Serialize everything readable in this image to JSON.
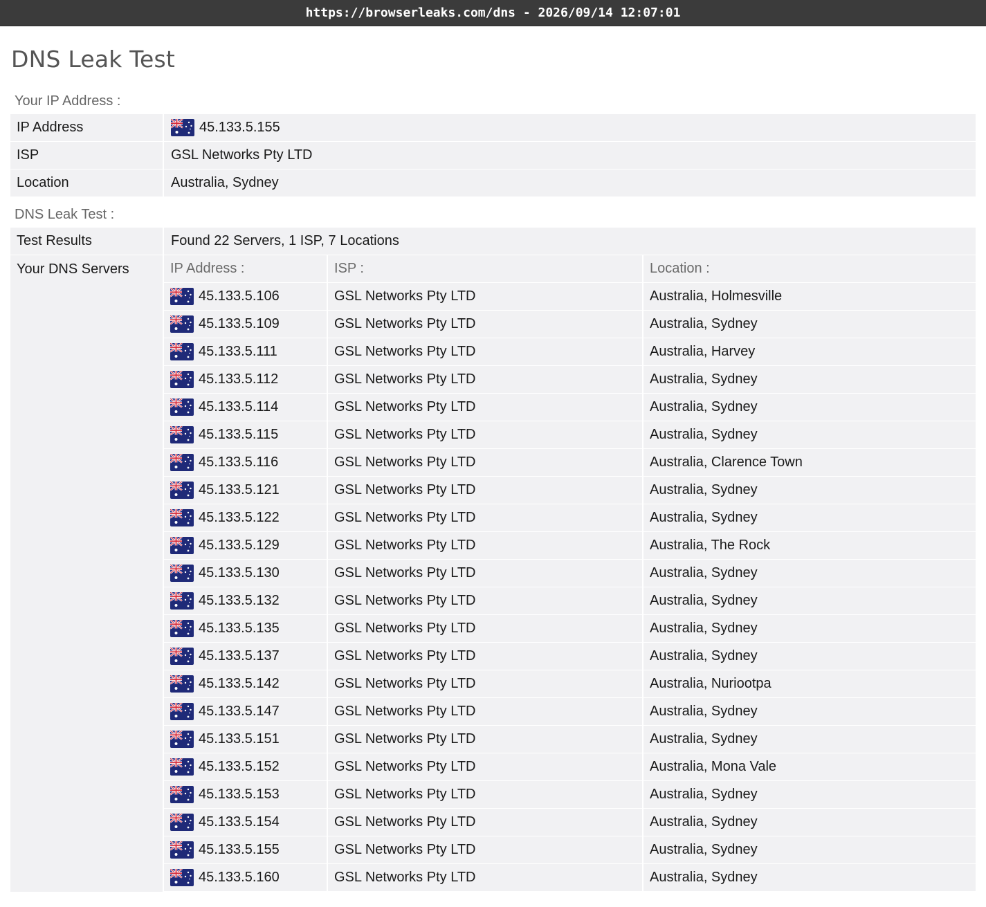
{
  "browser": {
    "url_timestamp": "https://browserleaks.com/dns - 2026/09/14 12:07:01"
  },
  "page": {
    "title": "DNS Leak Test"
  },
  "ip_section": {
    "heading": "Your IP Address :",
    "rows": [
      {
        "label": "IP Address",
        "value": "45.133.5.155",
        "flag": "australia-flag-icon"
      },
      {
        "label": "ISP",
        "value": "GSL Networks Pty LTD"
      },
      {
        "label": "Location",
        "value": "Australia, Sydney"
      }
    ]
  },
  "dns_section": {
    "heading": "DNS Leak Test :",
    "results_label": "Test Results",
    "results_value": "Found 22 Servers, 1 ISP, 7 Locations",
    "servers_label": "Your DNS Servers",
    "columns": [
      "IP Address :",
      "ISP :",
      "Location :"
    ],
    "servers": [
      {
        "ip": "45.133.5.106",
        "isp": "GSL Networks Pty LTD",
        "location": "Australia, Holmesville"
      },
      {
        "ip": "45.133.5.109",
        "isp": "GSL Networks Pty LTD",
        "location": "Australia, Sydney"
      },
      {
        "ip": "45.133.5.111",
        "isp": "GSL Networks Pty LTD",
        "location": "Australia, Harvey"
      },
      {
        "ip": "45.133.5.112",
        "isp": "GSL Networks Pty LTD",
        "location": "Australia, Sydney"
      },
      {
        "ip": "45.133.5.114",
        "isp": "GSL Networks Pty LTD",
        "location": "Australia, Sydney"
      },
      {
        "ip": "45.133.5.115",
        "isp": "GSL Networks Pty LTD",
        "location": "Australia, Sydney"
      },
      {
        "ip": "45.133.5.116",
        "isp": "GSL Networks Pty LTD",
        "location": "Australia, Clarence Town"
      },
      {
        "ip": "45.133.5.121",
        "isp": "GSL Networks Pty LTD",
        "location": "Australia, Sydney"
      },
      {
        "ip": "45.133.5.122",
        "isp": "GSL Networks Pty LTD",
        "location": "Australia, Sydney"
      },
      {
        "ip": "45.133.5.129",
        "isp": "GSL Networks Pty LTD",
        "location": "Australia, The Rock"
      },
      {
        "ip": "45.133.5.130",
        "isp": "GSL Networks Pty LTD",
        "location": "Australia, Sydney"
      },
      {
        "ip": "45.133.5.132",
        "isp": "GSL Networks Pty LTD",
        "location": "Australia, Sydney"
      },
      {
        "ip": "45.133.5.135",
        "isp": "GSL Networks Pty LTD",
        "location": "Australia, Sydney"
      },
      {
        "ip": "45.133.5.137",
        "isp": "GSL Networks Pty LTD",
        "location": "Australia, Sydney"
      },
      {
        "ip": "45.133.5.142",
        "isp": "GSL Networks Pty LTD",
        "location": "Australia, Nuriootpa"
      },
      {
        "ip": "45.133.5.147",
        "isp": "GSL Networks Pty LTD",
        "location": "Australia, Sydney"
      },
      {
        "ip": "45.133.5.151",
        "isp": "GSL Networks Pty LTD",
        "location": "Australia, Sydney"
      },
      {
        "ip": "45.133.5.152",
        "isp": "GSL Networks Pty LTD",
        "location": "Australia, Mona Vale"
      },
      {
        "ip": "45.133.5.153",
        "isp": "GSL Networks Pty LTD",
        "location": "Australia, Sydney"
      },
      {
        "ip": "45.133.5.154",
        "isp": "GSL Networks Pty LTD",
        "location": "Australia, Sydney"
      },
      {
        "ip": "45.133.5.155",
        "isp": "GSL Networks Pty LTD",
        "location": "Australia, Sydney"
      },
      {
        "ip": "45.133.5.160",
        "isp": "GSL Networks Pty LTD",
        "location": "Australia, Sydney"
      }
    ]
  },
  "colors": {
    "topbar_bg": "#3b3b3b",
    "row_bg": "#f1f1f3",
    "title_text": "#555555",
    "label_text": "#666666"
  }
}
